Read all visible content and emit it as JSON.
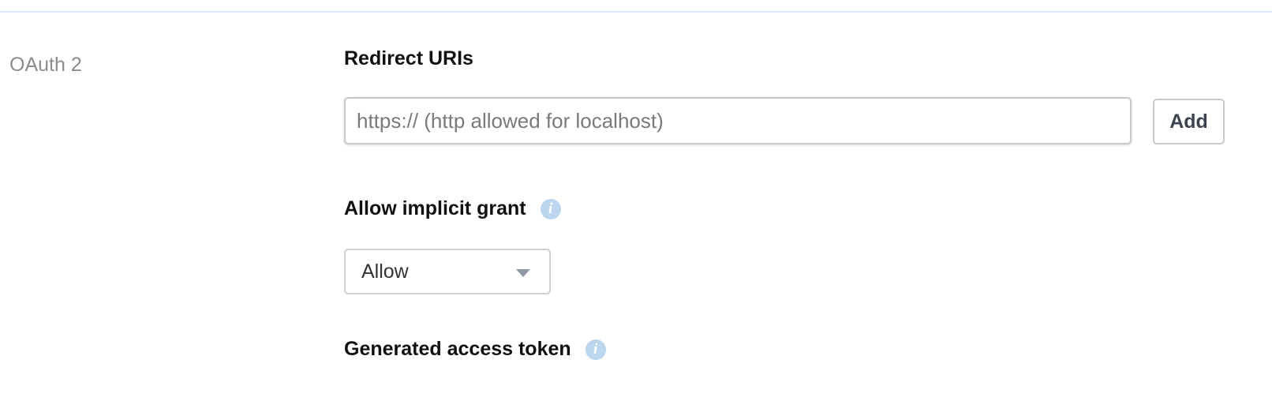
{
  "section": {
    "label": "OAuth 2"
  },
  "redirect_uris": {
    "label": "Redirect URIs",
    "input_value": "",
    "input_placeholder": "https:// (http allowed for localhost)",
    "add_label": "Add"
  },
  "implicit_grant": {
    "label": "Allow implicit grant",
    "info_icon": "info-icon",
    "selected": "Allow"
  },
  "access_token": {
    "label": "Generated access token",
    "info_icon": "info-icon"
  },
  "colors": {
    "divider": "#dbe7f3",
    "info_icon": "#bcd6ef",
    "section_label": "#8c8c8c",
    "button_text": "#3d4451"
  }
}
